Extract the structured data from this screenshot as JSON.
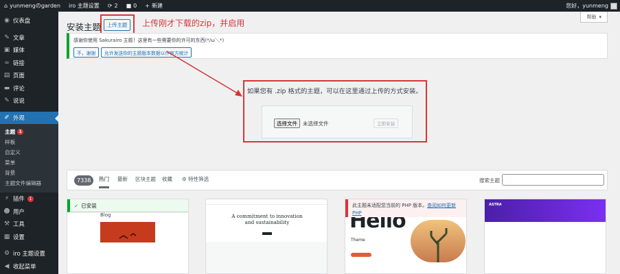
{
  "admin_bar": {
    "site": "yunmengのgarden",
    "theme_settings": "iro 主题设置",
    "updates": "2",
    "comments": "0",
    "new": "新建",
    "greeting": "您好，yunmeng"
  },
  "sidebar": {
    "items": [
      {
        "label": "仪表盘",
        "icon": "dashboard-icon"
      },
      {
        "label": "文章",
        "icon": "pin-icon"
      },
      {
        "label": "媒体",
        "icon": "media-icon"
      },
      {
        "label": "链接",
        "icon": "link-icon"
      },
      {
        "label": "页面",
        "icon": "page-icon"
      },
      {
        "label": "评论",
        "icon": "comment-icon"
      },
      {
        "label": "说说",
        "icon": "pin-icon"
      }
    ],
    "current": "外观",
    "submenu": [
      {
        "label": "主题",
        "badge": "1"
      },
      {
        "label": "样板"
      },
      {
        "label": "自定义"
      },
      {
        "label": "菜单"
      },
      {
        "label": "背景"
      },
      {
        "label": "主题文件编辑器"
      }
    ],
    "after": [
      {
        "label": "插件",
        "badge": "1"
      },
      {
        "label": "用户"
      },
      {
        "label": "工具"
      },
      {
        "label": "设置"
      }
    ],
    "iro": "iro 主题设置",
    "collapse": "收起菜单"
  },
  "help": "帮助",
  "page_title": "安装主题",
  "upload_button": "上传主题",
  "annotation": "上传刚才下载的zip，并启用",
  "notice": {
    "text": "感谢你使用 Sakurairo 主题！这里有一些需要你的许可的东西(*/ω＼*)",
    "deny": "不，谢谢",
    "allow": "允许发送你的主题版本数据以作官方统计"
  },
  "upload": {
    "text": "如果您有 .zip 格式的主题，可以在这里通过上传的方式安装。",
    "choose": "选择文件",
    "nofile": "未选择文件",
    "install": "立即安装"
  },
  "filter": {
    "count": "7338",
    "tabs": [
      "热门",
      "最新",
      "区块主题",
      "收藏"
    ],
    "feature": "特性筛选",
    "search_label": "搜索主题"
  },
  "cards": {
    "installed": "已安装",
    "blog": "Blog",
    "commitment": "A commitment to innovation and sustainability",
    "warn": "此主题未适配您当前的 PHP 版本。",
    "warn_link": "查阅如何更新 PHP",
    "hello": "Hello",
    "theme": "Theme",
    "astra": "ASTRA"
  }
}
